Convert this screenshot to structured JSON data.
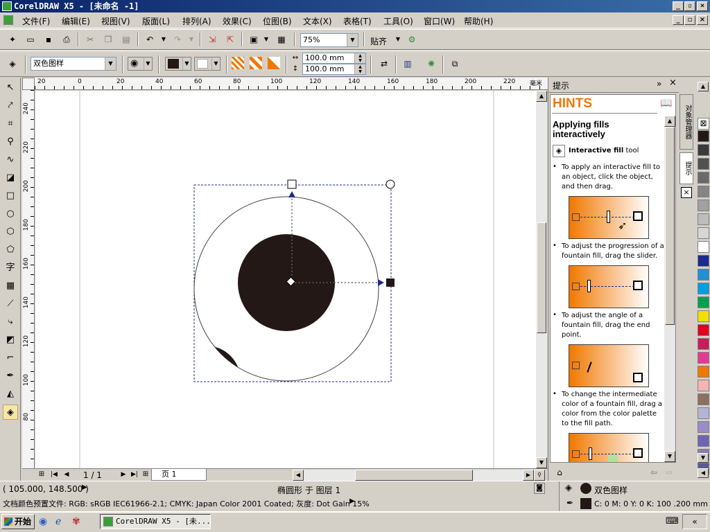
{
  "window": {
    "title": "CorelDRAW X5 - [未命名 -1]"
  },
  "menu": [
    "文件(F)",
    "编辑(E)",
    "视图(V)",
    "版面(L)",
    "排列(A)",
    "效果(C)",
    "位图(B)",
    "文本(X)",
    "表格(T)",
    "工具(O)",
    "窗口(W)",
    "帮助(H)"
  ],
  "standard_toolbar": {
    "zoom_value": "75%",
    "snap_label": "贴齐"
  },
  "property_bar": {
    "fill_type": "双色图样",
    "width_value": "100.0 mm",
    "height_value": "100.0 mm"
  },
  "rulers": {
    "h_labels": [
      "20",
      "0",
      "20",
      "40",
      "60",
      "80",
      "100",
      "120",
      "140",
      "160",
      "180",
      "200",
      "220",
      "毫米"
    ],
    "v_labels": [
      "240",
      "220",
      "200",
      "180",
      "160",
      "140",
      "120",
      "100",
      "80"
    ]
  },
  "page_nav": {
    "counter": "1 / 1",
    "page_tab": "页 1"
  },
  "docker": {
    "header": "提示",
    "hints_title": "HINTS",
    "heading": "Applying fills interactively",
    "tool_name": "Interactive fill",
    "tool_suffix": " tool",
    "hints": [
      "To apply an interactive fill to an object, click the object, and then drag.",
      "To adjust the progression of a fountain fill, drag the slider.",
      "To adjust the angle of a fountain fill, drag the end point.",
      "To change the intermediate color of a fountain fill, drag a color from the color palette to the fill path."
    ],
    "side_tabs": [
      "对象管理器",
      "提示"
    ]
  },
  "status": {
    "coords": "( 105.000, 148.500 )",
    "object_info": "椭圆形 于 图层 1",
    "profile": "文档颜色预置文件: RGB: sRGB IEC61966-2.1; CMYK: Japan Color 2001 Coated; 灰度: Dot Gain 15%",
    "fill_label": "双色图样",
    "outline_info": "C: 0 M: 0 Y: 0 K: 100  .200 mm"
  },
  "taskbar": {
    "start_label": "开始",
    "task_label": "CorelDRAW X5 - [未..."
  },
  "colors": {
    "titlebar": "#0a246a",
    "accent": "#f07800",
    "object_fill": "#231815"
  },
  "palette_colors": [
    "#231815",
    "#3a3a3a",
    "#505050",
    "#6a6a6a",
    "#858585",
    "#a0a0a0",
    "#bcbcbc",
    "#d6d6d6",
    "#ffffff",
    "#1b2a8c",
    "#1e90d6",
    "#00a0e0",
    "#00a050",
    "#f0e000",
    "#e00020",
    "#c81e5a",
    "#e03c96",
    "#f07800",
    "#f4b4b4",
    "#8c7060",
    "#b4b4d6",
    "#9a8cc8",
    "#6e64b4",
    "#8c78b4",
    "#5a5a96"
  ]
}
